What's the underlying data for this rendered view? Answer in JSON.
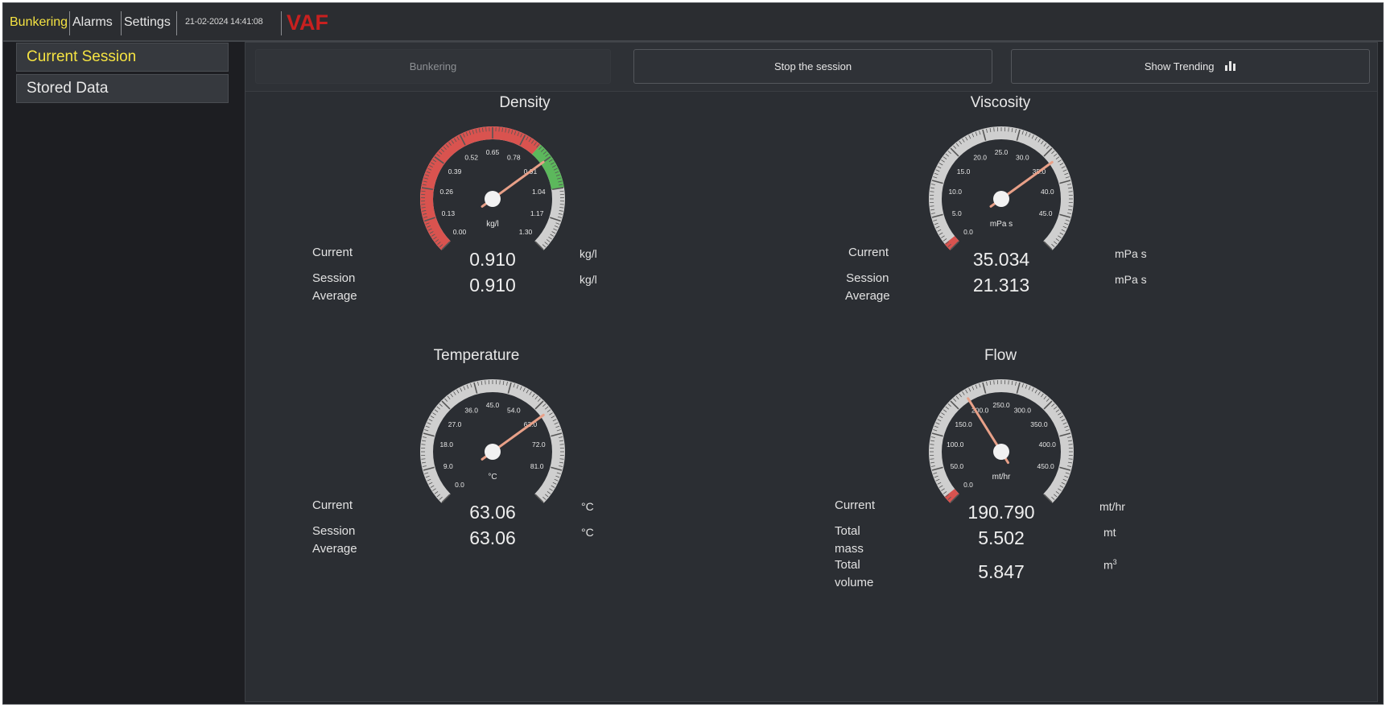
{
  "topbar": {
    "tabs": [
      "Bunkering",
      "Alarms",
      "Settings"
    ],
    "datetime": "21-02-2024 14:41:08",
    "logo": "VAF"
  },
  "sidebar": {
    "items": [
      "Current Session",
      "Stored Data"
    ]
  },
  "toolbar": {
    "bunkering_label": "Bunkering",
    "stop_label": "Stop the session",
    "trend_label": "Show Trending"
  },
  "gauges": {
    "density": {
      "title": "Density",
      "unit": "kg/l",
      "min": 0,
      "max": 1.3,
      "value": 0.91,
      "ticks": [
        "0.00",
        "0.13",
        "0.26",
        "0.39",
        "0.52",
        "0.65",
        "0.78",
        "0.91",
        "1.04",
        "1.17",
        "1.30"
      ],
      "zones": [
        {
          "from": 0,
          "to": 0.85,
          "color": "#d9534f"
        },
        {
          "from": 0.85,
          "to": 1.04,
          "color": "#5cb85c"
        }
      ]
    },
    "viscosity": {
      "title": "Viscosity",
      "unit": "mPa s",
      "min": 0,
      "max": 50,
      "value": 35.034,
      "ticks": [
        "0.0",
        "5.0",
        "10.0",
        "15.0",
        "20.0",
        "25.0",
        "30.0",
        "35.0",
        "40.0",
        "45.0"
      ],
      "zones": [
        {
          "from": 0,
          "to": 1.2,
          "color": "#d9534f"
        }
      ]
    },
    "temperature": {
      "title": "Temperature",
      "unit": "°C",
      "min": 0,
      "max": 90,
      "value": 63.06,
      "ticks": [
        "0.0",
        "9.0",
        "18.0",
        "27.0",
        "36.0",
        "45.0",
        "54.0",
        "63.0",
        "72.0",
        "81.0"
      ],
      "zones": []
    },
    "flow": {
      "title": "Flow",
      "unit": "mt/hr",
      "min": 0,
      "max": 500,
      "value": 190.79,
      "ticks": [
        "0.0",
        "50.0",
        "100.0",
        "150.0",
        "200.0",
        "250.0",
        "300.0",
        "350.0",
        "400.0",
        "450.0"
      ],
      "zones": [
        {
          "from": 0,
          "to": 12,
          "color": "#d9534f"
        }
      ]
    }
  },
  "readouts": {
    "density": {
      "current_label": "Current",
      "current_value": "0.910",
      "current_unit": "kg/l",
      "avg_label_1": "Session",
      "avg_label_2": "Average",
      "avg_value": "0.910",
      "avg_unit": "kg/l"
    },
    "viscosity": {
      "current_label": "Current",
      "current_value": "35.034",
      "current_unit": "mPa s",
      "avg_label_1": "Session",
      "avg_label_2": "Average",
      "avg_value": "21.313",
      "avg_unit": "mPa s"
    },
    "temperature": {
      "current_label": "Current",
      "current_value": "63.06",
      "current_unit": "°C",
      "avg_label_1": "Session",
      "avg_label_2": "Average",
      "avg_value": "63.06",
      "avg_unit": "°C"
    },
    "flow": {
      "current_label": "Current",
      "current_value": "190.790",
      "current_unit": "mt/hr",
      "mass_label_1": "Total",
      "mass_label_2": "mass",
      "mass_value": "5.502",
      "mass_unit": "mt",
      "volume_label_1": "Total",
      "volume_label_2": "volume",
      "volume_value": "5.847",
      "volume_unit": "m",
      "volume_unit_sup": "3"
    }
  },
  "colors": {
    "accent_yellow": "#f5e342",
    "logo_red": "#c8201f",
    "needle": "#e8a088",
    "zone_red": "#d9534f",
    "zone_green": "#5cb85c"
  }
}
